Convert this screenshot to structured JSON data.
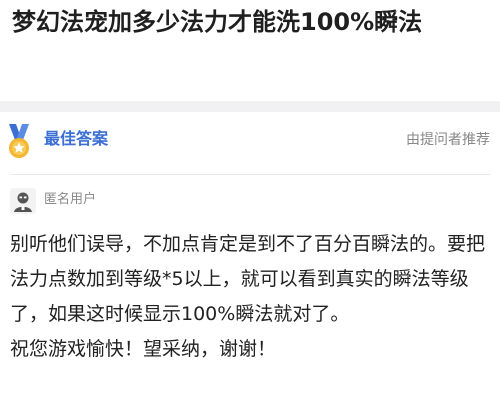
{
  "question": {
    "title": "梦幻法宠加多少法力才能洗100%瞬法"
  },
  "best_answer": {
    "icon": "medal-icon",
    "label": "最佳答案",
    "recommend_label": "由提问者推荐"
  },
  "answerer": {
    "avatar_icon": "anonymous-avatar-icon",
    "name": "匿名用户"
  },
  "answer": {
    "paragraph1": "别听他们误导，不加点肯定是到不了百分百瞬法的。要把法力点数加到等级*5以上，就可以看到真实的瞬法等级了，如果这时候显示100%瞬法就对了。",
    "paragraph2": "祝您游戏愉快！望采纳，谢谢！"
  },
  "colors": {
    "accent": "#3b6fd4",
    "medal_gold": "#f2b632",
    "muted_text": "#888888"
  }
}
